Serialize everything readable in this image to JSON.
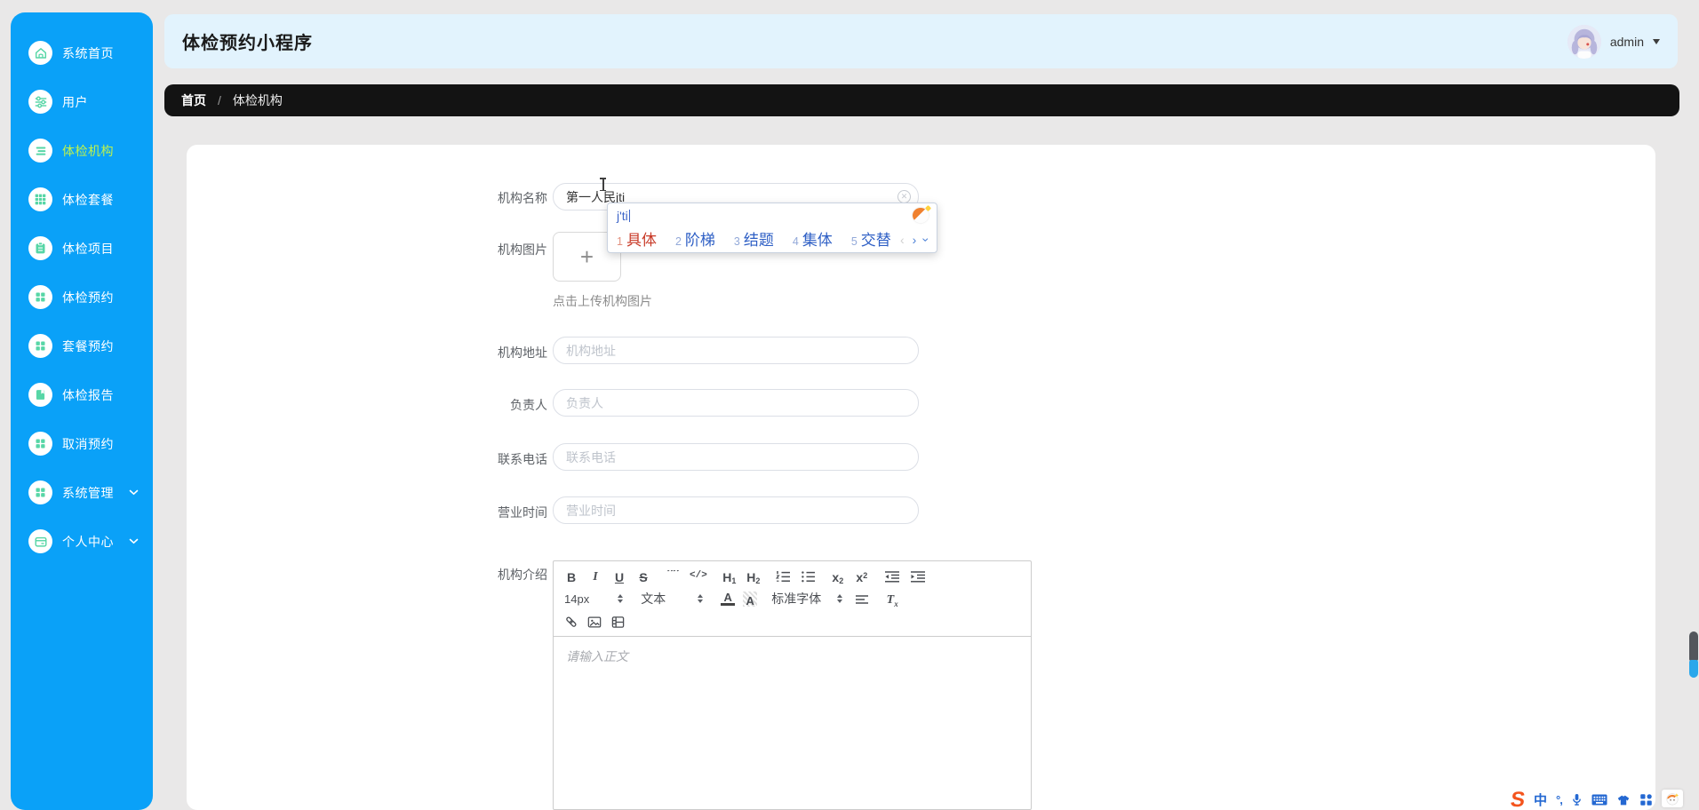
{
  "app": {
    "title": "体检预约小程序"
  },
  "header": {
    "user_name": "admin"
  },
  "sidebar": {
    "items": [
      {
        "label": "系统首页",
        "icon": "home-icon",
        "active": false
      },
      {
        "label": "用户",
        "icon": "sliders-icon",
        "active": false
      },
      {
        "label": "体检机构",
        "icon": "list-icon",
        "active": true
      },
      {
        "label": "体检套餐",
        "icon": "grid-9-icon",
        "active": false
      },
      {
        "label": "体检项目",
        "icon": "clipboard-icon",
        "active": false
      },
      {
        "label": "体检预约",
        "icon": "grid-4-icon",
        "active": false
      },
      {
        "label": "套餐预约",
        "icon": "grid-4-icon",
        "active": false
      },
      {
        "label": "体检报告",
        "icon": "report-icon",
        "active": false
      },
      {
        "label": "取消预约",
        "icon": "grid-4-icon",
        "active": false
      },
      {
        "label": "系统管理",
        "icon": "grid-4-icon",
        "active": false,
        "expandable": true
      },
      {
        "label": "个人中心",
        "icon": "id-card-icon",
        "active": false,
        "expandable": true
      }
    ]
  },
  "breadcrumb": {
    "home": "首页",
    "separator": "/",
    "current": "体检机构"
  },
  "form": {
    "name": {
      "label": "机构名称",
      "value": "第一人民jti"
    },
    "image": {
      "label": "机构图片",
      "hint": "点击上传机构图片",
      "plus": "+"
    },
    "address": {
      "label": "机构地址",
      "placeholder": "机构地址"
    },
    "manager": {
      "label": "负责人",
      "placeholder": "负责人"
    },
    "phone": {
      "label": "联系电话",
      "placeholder": "联系电话"
    },
    "hours": {
      "label": "营业时间",
      "placeholder": "营业时间"
    },
    "intro": {
      "label": "机构介绍"
    }
  },
  "editor": {
    "placeholder": "请输入正文",
    "size_value": "14px",
    "format_value": "文本",
    "font_value": "标准字体",
    "glyphs": {
      "bold": "B",
      "italic": "I",
      "underline": "U",
      "strike": "S",
      "quote": "””",
      "code": "</>",
      "h": "H",
      "h1_sub": "1",
      "h2_sub": "2",
      "sub_x": "x",
      "sub_n": "2",
      "sup_x": "x",
      "sup_n": "2",
      "color_letter": "A",
      "bg_letter": "A",
      "clean_t": "T",
      "clean_x": "x"
    }
  },
  "ime": {
    "composition": "j'ti",
    "candidates": [
      {
        "n": "1",
        "word": "具体"
      },
      {
        "n": "2",
        "word": "阶梯"
      },
      {
        "n": "3",
        "word": "结题"
      },
      {
        "n": "4",
        "word": "集体"
      },
      {
        "n": "5",
        "word": "交替"
      }
    ],
    "prev_arrow": "‹",
    "next_arrow": "›",
    "expand_arrow": "›"
  },
  "ime_bar": {
    "logo": "S",
    "mode": "中",
    "punct": "°,"
  },
  "colors": {
    "sidebar_bg": "#0aa1f8",
    "sidebar_icon": "#57d6a6",
    "active_item_text": "#bdf24d",
    "header_bg": "#e2f3fd",
    "breadcrumb_bg": "#131313",
    "card_bg": "#ffffff",
    "candidate_blue": "#2e5fc5",
    "candidate_red": "#c83a28",
    "ime_bar_blue": "#2468d2",
    "sogou_orange": "#f4541d",
    "scroll_thumb_blue": "#2aa7eb"
  }
}
